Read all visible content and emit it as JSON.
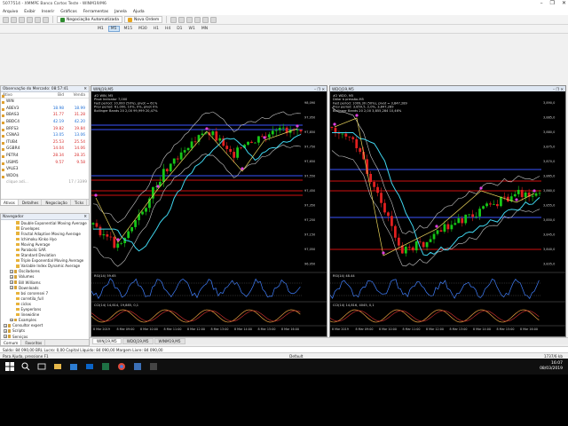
{
  "window": {
    "title": "5077514 - XMMPE Banco Cartos Teste - WINM19/M6",
    "controls": [
      "–",
      "❐",
      "✕"
    ]
  },
  "menu": [
    "Arquivo",
    "Exibir",
    "Inserir",
    "Gráficos",
    "Ferramentas",
    "Janela",
    "Ajuda"
  ],
  "toolbar": {
    "auto_trading": "Negociação Automatizada",
    "new_order": "Nova Ordem"
  },
  "timeframes": [
    "M1",
    "M5",
    "M15",
    "M30",
    "H1",
    "H4",
    "D1",
    "W1",
    "MN"
  ],
  "active_timeframe": "M5",
  "market_watch": {
    "title": "Observação do Mercado: 08:57:41",
    "columns": {
      "symbol": "Ativo",
      "bid": "Bid",
      "ask": "Venda"
    },
    "rows": [
      {
        "symbol": "WIN",
        "bid": "",
        "ask": "",
        "dir": "up"
      },
      {
        "symbol": "ABEV3",
        "bid": "18.98",
        "ask": "18.99",
        "dir": "up"
      },
      {
        "symbol": "BBAS3",
        "bid": "31.77",
        "ask": "31.28",
        "dir": "dn"
      },
      {
        "symbol": "BBDC4",
        "bid": "42.19",
        "ask": "42.20",
        "dir": "up"
      },
      {
        "symbol": "BRFS3",
        "bid": "19.82",
        "ask": "19.84",
        "dir": "dn"
      },
      {
        "symbol": "CSNA3",
        "bid": "13.05",
        "ask": "13.06",
        "dir": "up"
      },
      {
        "symbol": "ITUB4",
        "bid": "25.53",
        "ask": "25.54",
        "dir": "dn"
      },
      {
        "symbol": "GGBR4",
        "bid": "14.04",
        "ask": "14.06",
        "dir": "dn"
      },
      {
        "symbol": "PETR4",
        "bid": "28.34",
        "ask": "28.35",
        "dir": "dn"
      },
      {
        "symbol": "USIM5",
        "bid": "9.57",
        "ask": "9.58",
        "dir": "dn"
      },
      {
        "symbol": "VALE3",
        "bid": "",
        "ask": "",
        "dir": "up"
      },
      {
        "symbol": "WDO$",
        "bid": "",
        "ask": "",
        "dir": "up"
      }
    ],
    "add_hint": "clique adi...",
    "count": "17 / 3399",
    "tabs": [
      "Ativos",
      "Detalhes",
      "Negociação",
      "Ticks"
    ]
  },
  "navigator": {
    "title": "Navegador",
    "items": [
      {
        "label": "Double Exponential Moving Average",
        "level": 3
      },
      {
        "label": "Envelopes",
        "level": 3
      },
      {
        "label": "Fractal Adaptive Moving Average",
        "level": 3
      },
      {
        "label": "Ichimoku Kinko Hyo",
        "level": 3
      },
      {
        "label": "Moving Average",
        "level": 3
      },
      {
        "label": "Parabolic SAR",
        "level": 3
      },
      {
        "label": "Standard Deviation",
        "level": 3
      },
      {
        "label": "Triple Exponential Moving Average",
        "level": 3
      },
      {
        "label": "Variable Index Dynamic Average",
        "level": 3
      },
      {
        "label": "Osciladores",
        "level": 2
      },
      {
        "label": "Volumes",
        "level": 2
      },
      {
        "label": "Bill Williams",
        "level": 2
      },
      {
        "label": "Downloads",
        "level": 2
      },
      {
        "label": "bsi corsensei 7",
        "level": 3
      },
      {
        "label": "corretila_full",
        "level": 3
      },
      {
        "label": "ciclos",
        "level": 3
      },
      {
        "label": "Eyeperlans",
        "level": 3
      },
      {
        "label": "linewidine",
        "level": 3
      },
      {
        "label": "Examples",
        "level": 2
      },
      {
        "label": "Consultor expert",
        "level": 1
      },
      {
        "label": "Scripts",
        "level": 1
      },
      {
        "label": "Serviços",
        "level": 1
      }
    ],
    "tabs": [
      "Comum",
      "Favoritos"
    ]
  },
  "charts": [
    {
      "title": "WINJ19,M5",
      "info": [
        "#2 WIN, M5",
        "Pivot Indicator 7,000",
        "Fast period: 10,000 (50%), pivot = 61%",
        "Prev period: 61,000, 10%, 0%, pivot 0%",
        "Bollinger Bands 20 2,00 99,999 20,47%"
      ],
      "price_ticks": [
        "98,090",
        "97,950",
        "97,850",
        "97,750",
        "97,650",
        "97,550",
        "97,450",
        "97,350",
        "97,250",
        "97,150",
        "97,050",
        "96,950"
      ],
      "time_ticks": [
        "8 Mar 2019",
        "8 Mar 09:00",
        "8 Mar 10:00",
        "8 Mar 11:00",
        "8 Mar 12:00",
        "8 Mar 13:00",
        "8 Mar 14:00",
        "8 Mar 15:00",
        "8 Mar 16:00"
      ],
      "sub1_label": "RSI(14) 59.65",
      "sub2_label": "CCI(14) 14,614, 19,885, 0,1"
    },
    {
      "title": "WDOJ19,M5",
      "info": [
        "#2 WDO, M5",
        "Dólar à pressão-M5",
        "Fast period: 1009,30 (50%), pivot = 3,847,289",
        "Prev period: 3,859,5, 2,0%, 3,847,289",
        "Bollinger Bands 20 2,00 3,855,284 10,46%"
      ],
      "price_ticks": [
        "3,890,0",
        "3,885,0",
        "3,880,0",
        "3,875,0",
        "3,870,0",
        "3,865,0",
        "3,860,0",
        "3,855,0",
        "3,850,0",
        "3,845,0",
        "3,840,0",
        "3,835,0"
      ],
      "time_ticks": [
        "8 Mar 2019",
        "8 Mar 09:00",
        "8 Mar 10:00",
        "8 Mar 11:00",
        "8 Mar 12:00",
        "8 Mar 13:00",
        "8 Mar 14:00",
        "8 Mar 15:00",
        "8 Mar 16:00"
      ],
      "sub1_label": "RSI(14) 48.44",
      "sub2_label": "CCI(14) 14,816, 4045, 0,1"
    }
  ],
  "chart_tabs": [
    "WINJ19,M5",
    "WDOJ19,M5",
    "WINM19,M5"
  ],
  "status": {
    "text": "Saldo: 84 090,00 BRL   Lucro: 0,00   Capital Líquido: 84 090,00   Margem Livre: 84 090,00"
  },
  "help": {
    "left": "Para Ajuda, pressione F1",
    "mid": "Default",
    "right": "1737/6 kb"
  },
  "clock": {
    "time": "16:07",
    "date": "08/03/2019"
  },
  "colors": {
    "bull": "#17c717",
    "bear": "#e22020",
    "band": "#c8c8c8",
    "pivot": "#e8d35a",
    "ma": "#3fd6ef",
    "level_blue": "#3a55ff",
    "level_red": "#d01010",
    "point": "#e040e0"
  }
}
